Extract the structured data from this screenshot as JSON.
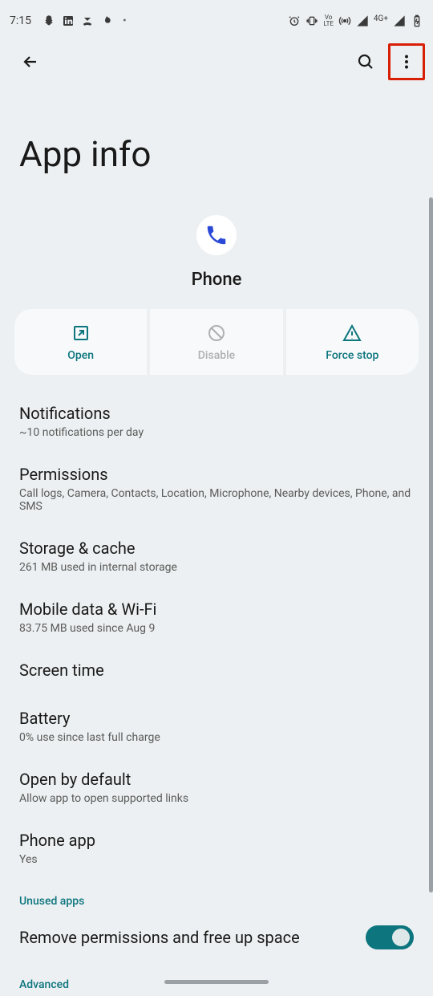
{
  "status_bar": {
    "time": "7:15",
    "network_type": "4G+"
  },
  "page": {
    "title": "App info"
  },
  "app": {
    "name": "Phone"
  },
  "actions": {
    "open": "Open",
    "disable": "Disable",
    "force_stop": "Force stop"
  },
  "settings": [
    {
      "title": "Notifications",
      "subtitle": "~10 notifications per day"
    },
    {
      "title": "Permissions",
      "subtitle": "Call logs, Camera, Contacts, Location, Microphone, Nearby devices, Phone, and SMS"
    },
    {
      "title": "Storage & cache",
      "subtitle": "261 MB used in internal storage"
    },
    {
      "title": "Mobile data & Wi-Fi",
      "subtitle": "83.75 MB used since Aug 9"
    },
    {
      "title": "Screen time",
      "subtitle": ""
    },
    {
      "title": "Battery",
      "subtitle": "0% use since last full charge"
    },
    {
      "title": "Open by default",
      "subtitle": "Allow app to open supported links"
    },
    {
      "title": "Phone app",
      "subtitle": "Yes"
    }
  ],
  "section_unused": "Unused apps",
  "toggle_remove": "Remove permissions and free up space",
  "section_advanced": "Advanced",
  "colors": {
    "accent": "#0c757e",
    "highlight": "#d81e05",
    "phone_icon": "#2a49d6"
  }
}
